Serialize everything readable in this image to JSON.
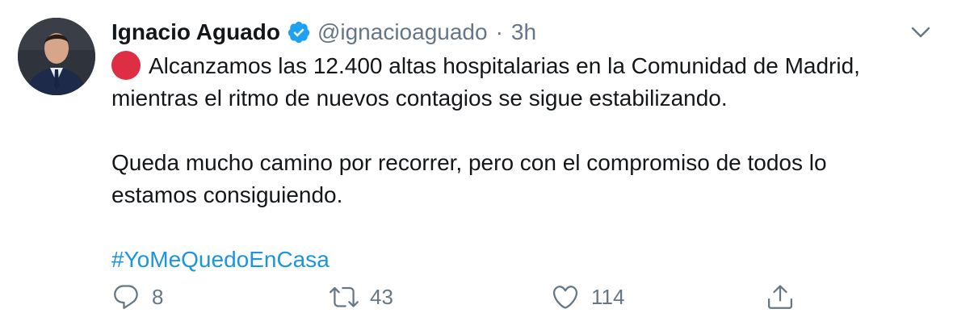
{
  "tweet": {
    "author_name": "Ignacio Aguado",
    "handle": "@ignacioaguado",
    "separator": "·",
    "time": "3h",
    "body": {
      "line1": "Alcanzamos las 12.400 altas hospitalarias en la Comunidad de Madrid,",
      "line2": "mientras el ritmo de nuevos contagios se sigue estabilizando.",
      "line3": "Queda mucho camino por recorrer, pero con el compromiso de todos lo",
      "line4": "estamos consiguiendo.",
      "hashtag": "#YoMeQuedoEnCasa"
    },
    "actions": {
      "replies": "8",
      "retweets": "43",
      "likes": "114"
    },
    "colors": {
      "link": "#1b95e0",
      "muted": "#657786",
      "verified": "#1da1f2",
      "red_circle": "#dd2e44"
    },
    "icons": [
      "verified-badge-icon",
      "chevron-down-icon",
      "red-circle-emoji",
      "reply-icon",
      "retweet-icon",
      "like-icon",
      "share-icon"
    ]
  }
}
